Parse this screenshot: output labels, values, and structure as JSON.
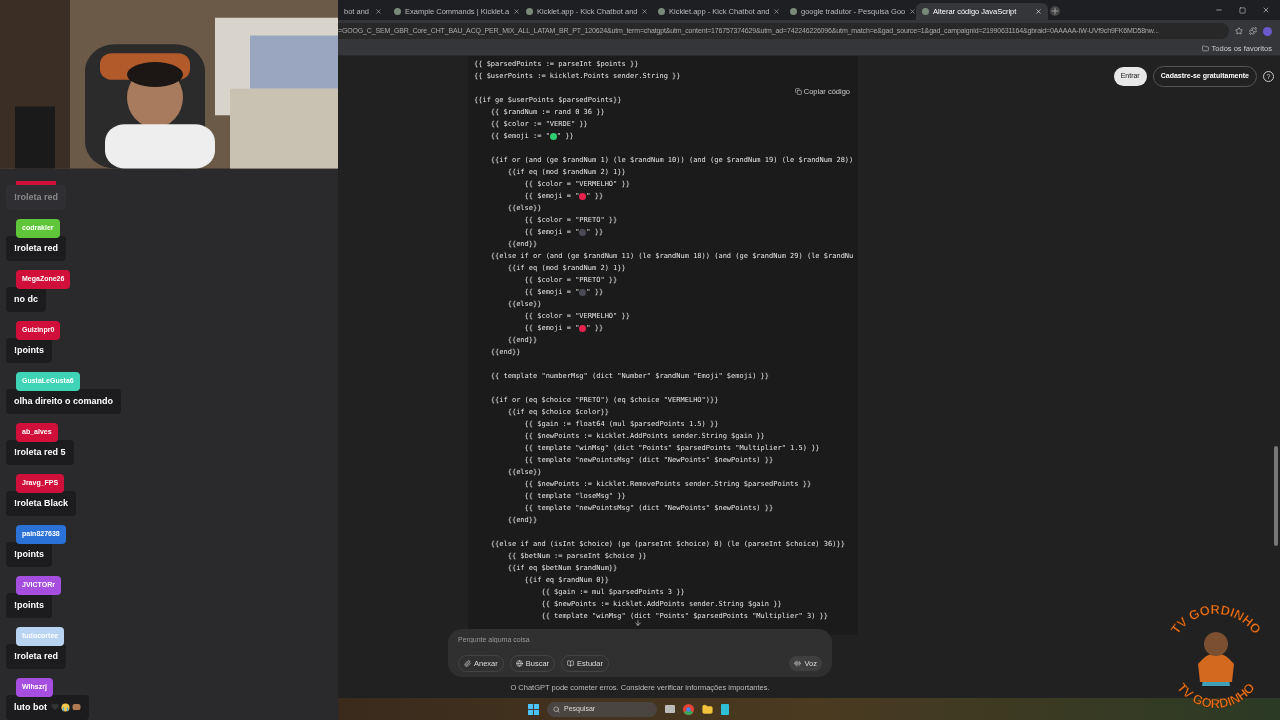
{
  "chat": [
    {
      "color": "#d0103a",
      "message": "!roleta red",
      "faded": true
    },
    {
      "user": "codrakler",
      "color": "#5fc63a",
      "message": "!roleta red",
      "faded": false
    },
    {
      "user": "MegaZone26",
      "color": "#d0103a",
      "message": "no dc",
      "faded": false
    },
    {
      "user": "Guizinpr0",
      "color": "#d0103a",
      "message": "!points",
      "faded": false
    },
    {
      "user": "GustaLeGusta6",
      "color": "#3fd4b6",
      "message": "olha direito o comando",
      "faded": false
    },
    {
      "user": "ab_alves",
      "color": "#d0103a",
      "message": "!roleta red 5",
      "faded": false
    },
    {
      "user": "Jravg_FPS",
      "color": "#d0103a",
      "message": "!roleta Black",
      "faded": false
    },
    {
      "user": "pain827638",
      "color": "#2a72d8",
      "message": "!points",
      "faded": false
    },
    {
      "user": "JVICTORr",
      "color": "#a64ee0",
      "message": "!points",
      "faded": false
    },
    {
      "user": "tudocortee",
      "color": "#b8d4f2",
      "message": "!roleta red",
      "faded": false
    },
    {
      "user": "Wlhszrj",
      "color": "#a64ee0",
      "message": "luto bot",
      "faded": false
    }
  ],
  "browser": {
    "tabs": [
      {
        "title": "bot and",
        "selected": false
      },
      {
        "title": "Example Commands | Kicklet.a",
        "selected": false
      },
      {
        "title": "Kicklet.app - Kick Chatbot and",
        "selected": false
      },
      {
        "title": "Kicklet.app - Kick Chatbot and",
        "selected": false
      },
      {
        "title": "google tradutor - Pesquisa Goo",
        "selected": false
      },
      {
        "title": "Alterar código JavaScript",
        "selected": true
      }
    ],
    "url": "=GOOG_C_SEM_GBR_Core_CHT_BAU_ACQ_PER_MIX_ALL_LATAM_BR_PT_120624&utm_term=chatgpt&utm_content=176757374629&utm_ad=742246226096&utm_match=e&gad_source=1&gad_campaignid=21990631164&gbraid=0AAAAA-IW-UVf9ch9FK6MD58nw...",
    "bookmarks": "Todos os favoritos"
  },
  "header": {
    "login": "Entrar",
    "signup": "Cadastre-se gratuitamente",
    "help": "?"
  },
  "code": {
    "copy": "Copiar código",
    "lines": [
      {
        "kind": "code",
        "text": "{{ $parsedPoints := parseInt $points }}"
      },
      {
        "kind": "code",
        "text": "{{ $userPoints := kicklet.Points sender.String }}"
      },
      {
        "kind": "blank"
      },
      {
        "kind": "code",
        "text": "{{if ge $userPoints $parsedPoints}}"
      },
      {
        "kind": "code",
        "text": "    {{ $randNum := rand 0 36 }}"
      },
      {
        "kind": "code",
        "text": "    {{ $color := \"VERDE\" }}"
      },
      {
        "kind": "emoji",
        "before": "    {{ $emoji := \"",
        "color": "#2ecc71",
        "after": "\" }}"
      },
      {
        "kind": "blank"
      },
      {
        "kind": "code",
        "text": "    {{if or (and (ge $randNum 1) (le $randNum 10)) (and (ge $randNum 19) (le $randNum 28))"
      },
      {
        "kind": "code",
        "text": "        {{if eq (mod $randNum 2) 1}}"
      },
      {
        "kind": "code",
        "text": "            {{ $color = \"VERMELHO\" }}"
      },
      {
        "kind": "emoji",
        "before": "            {{ $emoji = \"",
        "color": "#e8214f",
        "after": "\" }}"
      },
      {
        "kind": "code",
        "text": "        {{else}}"
      },
      {
        "kind": "code",
        "text": "            {{ $color = \"PRETO\" }}"
      },
      {
        "kind": "emoji",
        "before": "            {{ $emoji = \"",
        "color": "#4a4a55",
        "after": "\" }}"
      },
      {
        "kind": "code",
        "text": "        {{end}}"
      },
      {
        "kind": "code",
        "text": "    {{else if or (and (ge $randNum 11) (le $randNum 18)) (and (ge $randNum 29) (le $randNu"
      },
      {
        "kind": "code",
        "text": "        {{if eq (mod $randNum 2) 1}}"
      },
      {
        "kind": "code",
        "text": "            {{ $color = \"PRETO\" }}"
      },
      {
        "kind": "emoji",
        "before": "            {{ $emoji = \"",
        "color": "#4a4a55",
        "after": "\" }}"
      },
      {
        "kind": "code",
        "text": "        {{else}}"
      },
      {
        "kind": "code",
        "text": "            {{ $color = \"VERMELHO\" }}"
      },
      {
        "kind": "emoji",
        "before": "            {{ $emoji = \"",
        "color": "#e8214f",
        "after": "\" }}"
      },
      {
        "kind": "code",
        "text": "        {{end}}"
      },
      {
        "kind": "code",
        "text": "    {{end}}"
      },
      {
        "kind": "blank"
      },
      {
        "kind": "code",
        "text": "    {{ template \"numberMsg\" (dict \"Number\" $randNum \"Emoji\" $emoji) }}"
      },
      {
        "kind": "blank"
      },
      {
        "kind": "code",
        "text": "    {{if or (eq $choice \"PRETO\") (eq $choice \"VERMELHO\")}}"
      },
      {
        "kind": "code",
        "text": "        {{if eq $choice $color}}"
      },
      {
        "kind": "code",
        "text": "            {{ $gain := float64 (mul $parsedPoints 1.5) }}"
      },
      {
        "kind": "code",
        "text": "            {{ $newPoints := kicklet.AddPoints sender.String $gain }}"
      },
      {
        "kind": "code",
        "text": "            {{ template \"winMsg\" (dict \"Points\" $parsedPoints \"Multiplier\" 1.5) }}"
      },
      {
        "kind": "code",
        "text": "            {{ template \"newPointsMsg\" (dict \"NewPoints\" $newPoints) }}"
      },
      {
        "kind": "code",
        "text": "        {{else}}"
      },
      {
        "kind": "code",
        "text": "            {{ $newPoints := kicklet.RemovePoints sender.String $parsedPoints }}"
      },
      {
        "kind": "code",
        "text": "            {{ template \"loseMsg\" }}"
      },
      {
        "kind": "code",
        "text": "            {{ template \"newPointsMsg\" (dict \"NewPoints\" $newPoints) }}"
      },
      {
        "kind": "code",
        "text": "        {{end}}"
      },
      {
        "kind": "blank"
      },
      {
        "kind": "code",
        "text": "    {{else if and (isInt $choice) (ge (parseInt $choice) 0) (le (parseInt $choice) 36)}}"
      },
      {
        "kind": "code",
        "text": "        {{ $betNum := parseInt $choice }}"
      },
      {
        "kind": "code",
        "text": "        {{if eq $betNum $randNum}}"
      },
      {
        "kind": "code",
        "text": "            {{if eq $randNum 0}}"
      },
      {
        "kind": "code",
        "text": "                {{ $gain := mul $parsedPoints 3 }}"
      },
      {
        "kind": "code",
        "text": "                {{ $newPoints := kicklet.AddPoints sender.String $gain }}"
      },
      {
        "kind": "code",
        "text": "                {{ template \"winMsg\" (dict \"Points\" $parsedPoints \"Multiplier\" 3) }}"
      }
    ]
  },
  "composer": {
    "placeholder": "Pergunte alguma coisa",
    "buttons": [
      "Anexar",
      "Buscar",
      "Estudar"
    ],
    "voice": "Voz"
  },
  "disclaimer": "O ChatGPT pode cometer erros. Considere verificar informações importantes.",
  "taskbar": {
    "search": "Pesquisar"
  },
  "logo": {
    "top": "TV GORDINHO",
    "bottom": "TV GORDINHO"
  }
}
